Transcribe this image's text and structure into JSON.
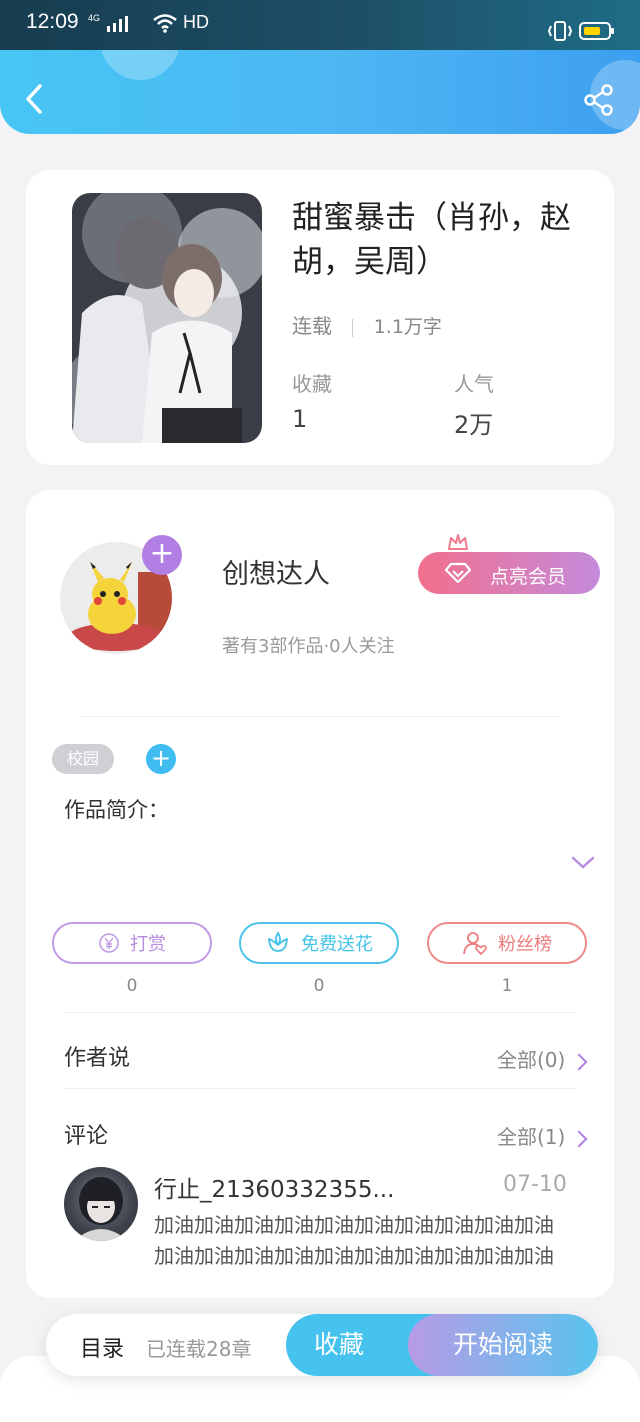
{
  "status_bar": {
    "time": "12:09",
    "network": "4G",
    "hd": "HD"
  },
  "book": {
    "title": "甜蜜暴击（肖孙，赵胡，吴周）",
    "status": "连载",
    "word_count": "1.1万字",
    "favorites_label": "收藏",
    "favorites_value": "1",
    "popularity_label": "人气",
    "popularity_value": "2万"
  },
  "author_card": {
    "name": "创想达人",
    "works_info": "著有3部作品·0人关注",
    "vip_button": "点亮会员",
    "tag": "校园",
    "intro_label": "作品简介："
  },
  "actions": [
    {
      "label": "打赏",
      "count": "0",
      "color": "#b98ce0"
    },
    {
      "label": "免费送花",
      "count": "0",
      "color": "#45c3e8"
    },
    {
      "label": "粉丝榜",
      "count": "1",
      "color": "#ee7b7b"
    }
  ],
  "author_says": {
    "label": "作者说",
    "link": "全部(0)"
  },
  "comments": {
    "label": "评论",
    "link": "全部(1)",
    "items": [
      {
        "user": "行止_21360332355...",
        "date": "07-10",
        "text": "加油加油加油加油加油加油加油加油加油加油加油加油加油加油加油加油加油加油加油加油"
      }
    ]
  },
  "bottom_bar": {
    "toc": "目录",
    "info": "已连载28章",
    "collect": "收藏",
    "read": "开始阅读"
  }
}
